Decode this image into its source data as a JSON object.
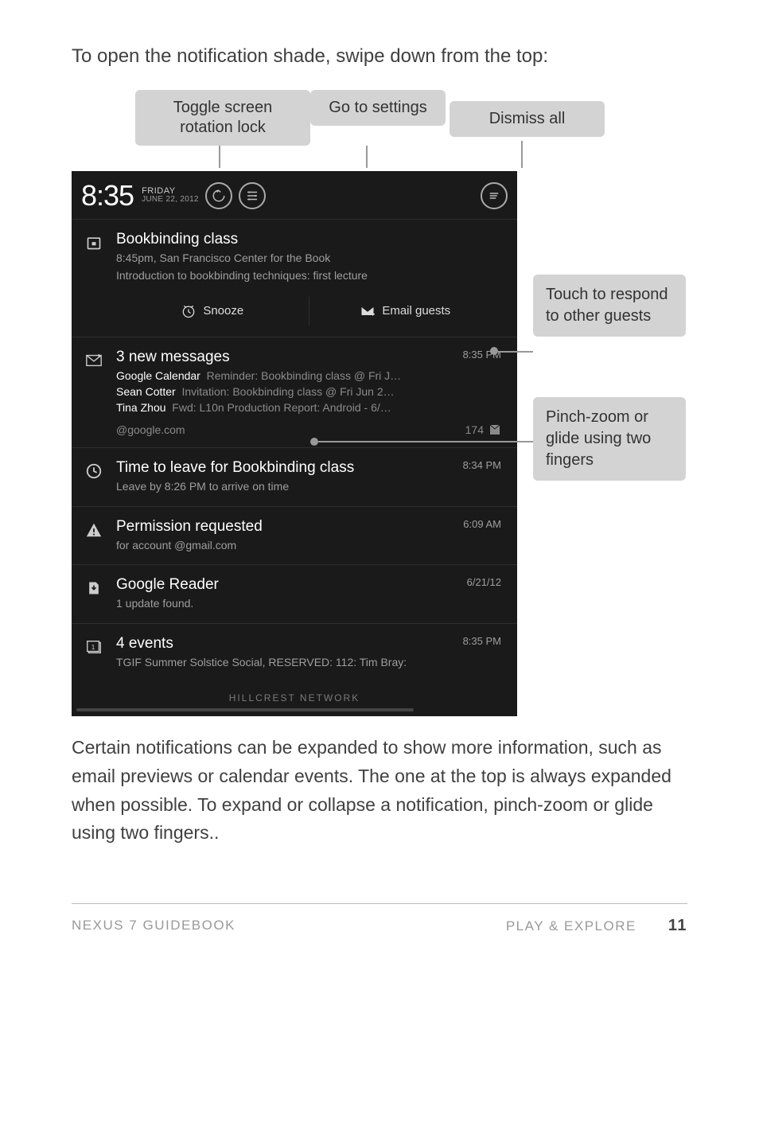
{
  "intro": "To open the notification shade, swipe down from the top:",
  "callouts": {
    "rotation": "Toggle screen rotation lock",
    "settings": "Go to settings",
    "dismiss": "Dismiss all",
    "touch": "Touch to respond to other guests",
    "pinch": "Pinch-zoom or glide using two fingers"
  },
  "status": {
    "time": "8:35",
    "day": "FRIDAY",
    "date": "JUNE 22, 2012"
  },
  "notifications": {
    "bookbinding": {
      "title": "Bookbinding class",
      "subtitle": "8:45pm, San Francisco Center for the Book",
      "desc": "Introduction to bookbinding techniques: first lecture",
      "snooze": "Snooze",
      "email": "Email guests"
    },
    "messages": {
      "title": "3 new messages",
      "time": "8:35 PM",
      "line1_sender": "Google Calendar",
      "line1_rest": "Reminder: Bookbinding class @ Fri J…",
      "line2_sender": "Sean Cotter",
      "line2_rest": "Invitation: Bookbinding class @ Fri Jun 2…",
      "line3_sender": "Tina Zhou",
      "line3_rest": "Fwd: L10n Production Report: Android - 6/…",
      "account": "@google.com",
      "count": "174"
    },
    "leave": {
      "title": "Time to leave for Bookbinding class",
      "time": "8:34 PM",
      "sub": "Leave by 8:26 PM to arrive on time"
    },
    "perm": {
      "title": "Permission requested",
      "time": "6:09 AM",
      "sub": "for account @gmail.com"
    },
    "reader": {
      "title": "Google Reader",
      "time": "6/21/12",
      "sub": "1 update found."
    },
    "events": {
      "title": "4 events",
      "time": "8:35 PM",
      "sub": "TGIF Summer Solstice Social, RESERVED: 112: Tim Bray:"
    },
    "network": "HILLCREST NETWORK"
  },
  "bodytext": "Certain notifications can be expanded to show more information, such as email previews or calendar events. The one at the top is always expanded when possible. To expand or collapse a notification, pinch-zoom or glide using two fingers..",
  "footer": {
    "left": "NEXUS 7 GUIDEBOOK",
    "section": "PLAY & EXPLORE",
    "page": "11"
  }
}
